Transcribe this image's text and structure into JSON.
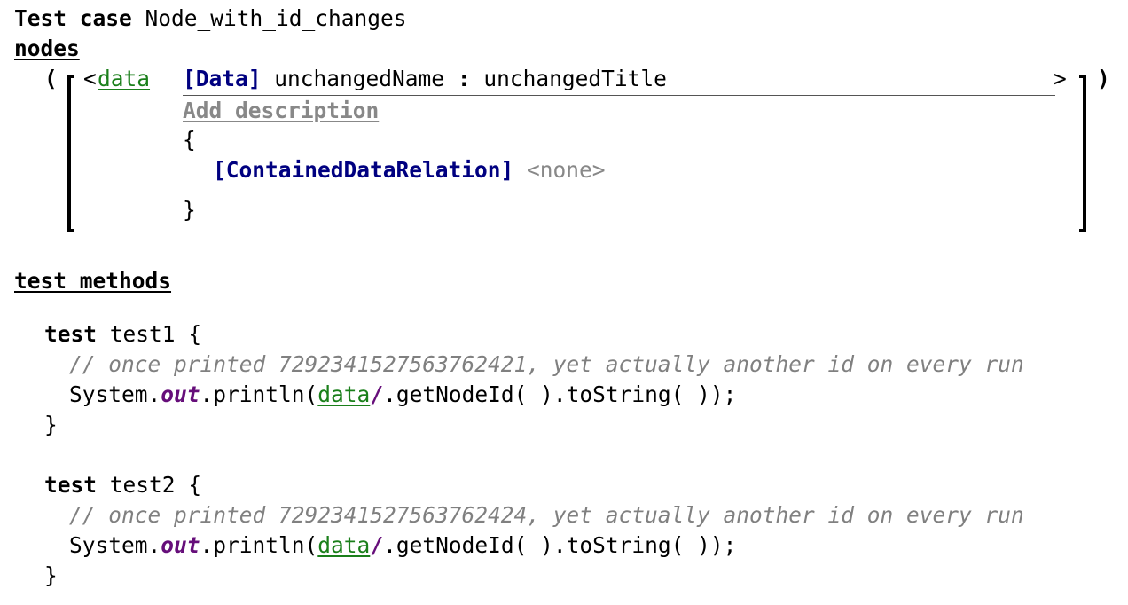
{
  "header": {
    "keyword": "Test case",
    "name": "Node_with_id_changes"
  },
  "nodes_section": {
    "label": "nodes",
    "open_paren": "(",
    "close_paren": ")",
    "lt": "<",
    "gt": ">",
    "node": {
      "ref": "data",
      "concept": "[Data]",
      "name": "unchangedName",
      "colon": ":",
      "title": "unchangedTitle",
      "add_description": "Add description",
      "open_brace": "{",
      "close_brace": "}",
      "relation": "[ContainedDataRelation]",
      "relation_value": "<none>"
    }
  },
  "test_methods": {
    "label": "test methods",
    "methods": [
      {
        "keyword": "test",
        "name": "test1",
        "open_brace": "{",
        "comment": "// once printed 7292341527563762421, yet actually another id on every run",
        "code_prefix": "System.",
        "code_field": "out",
        "code_mid": ".println(",
        "code_ref": "data",
        "code_slash": "/",
        "code_suffix": ".getNodeId( ).toString( ));",
        "close_brace": "}"
      },
      {
        "keyword": "test",
        "name": "test2",
        "open_brace": "{",
        "comment": "// once printed 7292341527563762424, yet actually another id on every run",
        "code_prefix": "System.",
        "code_field": "out",
        "code_mid": ".println(",
        "code_ref": "data",
        "code_slash": "/",
        "code_suffix": ".getNodeId( ).toString( ));",
        "close_brace": "}"
      }
    ]
  }
}
